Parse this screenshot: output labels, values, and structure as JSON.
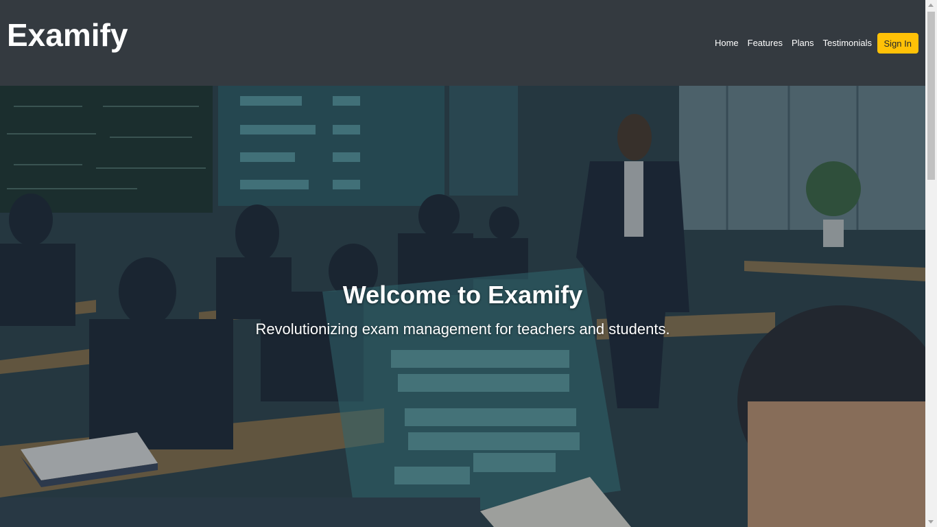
{
  "brand": {
    "name": "Examify"
  },
  "nav": {
    "items": [
      {
        "label": "Home"
      },
      {
        "label": "Features"
      },
      {
        "label": "Plans"
      },
      {
        "label": "Testimonials"
      }
    ],
    "signin_label": "Sign In"
  },
  "hero": {
    "title": "Welcome to Examify",
    "subtitle": "Revolutionizing exam management for teachers and students.",
    "background_image": "classroom-exam-illustration"
  },
  "colors": {
    "navbar_bg": "#343a40",
    "accent": "#ffc107",
    "text_light": "#ffffff"
  }
}
